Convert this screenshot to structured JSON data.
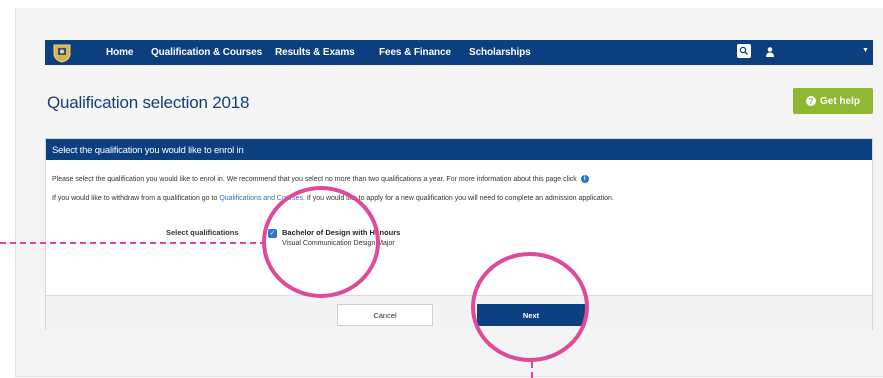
{
  "nav": {
    "items": [
      "Home",
      "Qualification & Courses",
      "Results & Exams",
      "Fees & Finance",
      "Scholarships"
    ],
    "icons": {
      "logo": "crest-logo-icon",
      "search": "search-icon",
      "user": "user-icon",
      "menu": "caret-down-icon"
    }
  },
  "page": {
    "title": "Qualification selection 2018",
    "help_label": "Get help"
  },
  "panel": {
    "header": "Select the qualification you would like to enrol in",
    "line1": "Please select the qualification you would like to enrol in. We recommend that you select no more than two qualifications a year. For more information about this page click",
    "line2_before": "If you would like to withdraw from a qualification go to",
    "line2_link": "Qualifications and Courses",
    "line2_after": ". If you would like to apply for a new qualification you will need to complete an admission application.",
    "select_label": "Select qualifications",
    "qualification": {
      "name": "Bachelor of Design with Honours",
      "major": "Visual Communication Design Major",
      "checked": true
    },
    "cancel_label": "Cancel",
    "next_label": "Next"
  },
  "colors": {
    "navy": "#0b3f80",
    "help_green": "#8fb832",
    "annotation_pink": "#e0489a",
    "link_blue": "#2f6fbf"
  }
}
